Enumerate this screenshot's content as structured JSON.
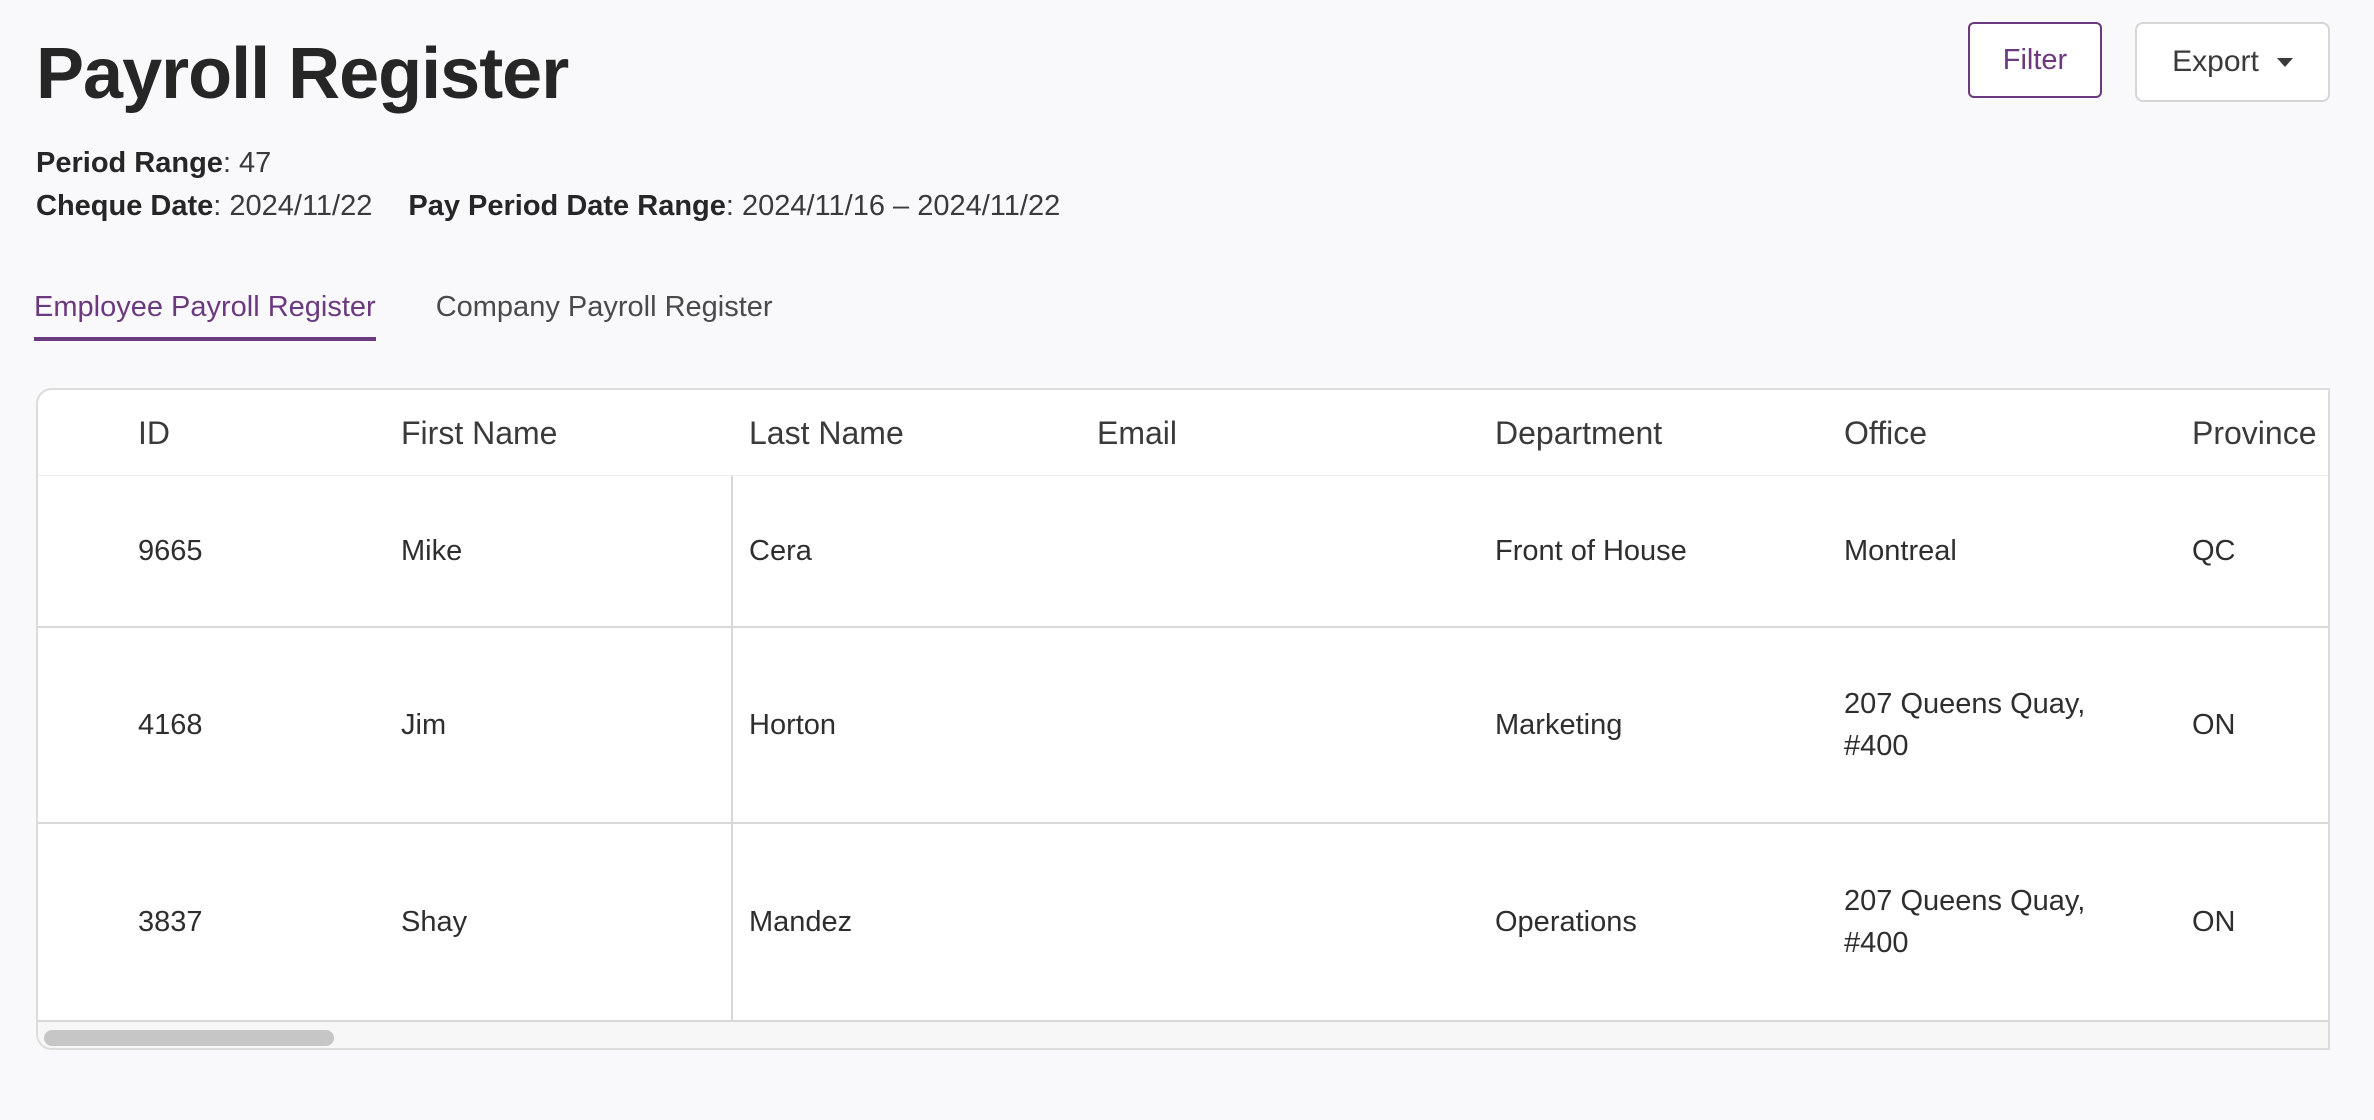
{
  "page": {
    "title": "Payroll Register"
  },
  "toolbar": {
    "filter_label": "Filter",
    "export_label": "Export"
  },
  "meta": {
    "period_range_label": "Period Range",
    "period_range_value": ": 47",
    "cheque_date_label": "Cheque Date",
    "cheque_date_value": ": 2024/11/22",
    "pay_period_label": "Pay Period Date Range",
    "pay_period_value": ": 2024/11/16 – 2024/11/22"
  },
  "tabs": [
    {
      "label": "Employee Payroll Register",
      "active": true
    },
    {
      "label": "Company Payroll Register",
      "active": false
    }
  ],
  "table": {
    "columns": [
      "ID",
      "First Name",
      "Last Name",
      "Email",
      "Department",
      "Office",
      "Province"
    ],
    "rows": [
      {
        "id": "9665",
        "first": "Mike",
        "last": "Cera",
        "email": "",
        "department": "Front of House",
        "office": "Montreal",
        "province": "QC"
      },
      {
        "id": "4168",
        "first": "Jim",
        "last": "Horton",
        "email": "",
        "department": "Marketing",
        "office": "207 Queens Quay, #400",
        "province": "ON"
      },
      {
        "id": "3837",
        "first": "Shay",
        "last": "Mandez",
        "email": "",
        "department": "Operations",
        "office": "207 Queens Quay, #400",
        "province": "ON"
      }
    ]
  },
  "colors": {
    "accent": "#6b3a7e",
    "background": "#f9f9fb"
  }
}
